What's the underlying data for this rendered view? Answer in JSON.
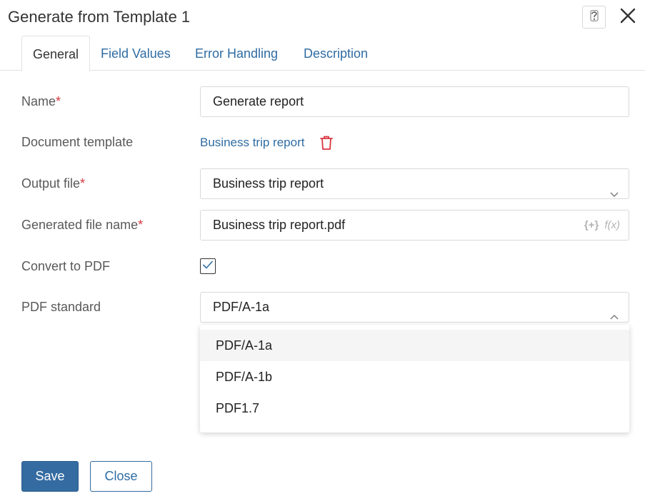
{
  "dialog": {
    "title": "Generate from Template 1"
  },
  "tabs": [
    {
      "label": "General",
      "active": true
    },
    {
      "label": "Field Values",
      "active": false
    },
    {
      "label": "Error Handling",
      "active": false
    },
    {
      "label": "Description",
      "active": false
    }
  ],
  "form": {
    "name": {
      "label": "Name",
      "required_mark": "*",
      "value": "Generate report"
    },
    "document_template": {
      "label": "Document template",
      "link_text": "Business trip report"
    },
    "output_file": {
      "label": "Output file",
      "required_mark": "*",
      "value": "Business trip report"
    },
    "generated_file_name": {
      "label": "Generated file name",
      "required_mark": "*",
      "value": "Business trip report.pdf",
      "insert_icon_text": "{+}",
      "formula_icon_text": "f(x)"
    },
    "convert_to_pdf": {
      "label": "Convert to PDF",
      "checked": true
    },
    "pdf_standard": {
      "label": "PDF standard",
      "value": "PDF/A-1a",
      "options": [
        "PDF/A-1a",
        "PDF/A-1b",
        "PDF1.7"
      ]
    }
  },
  "footer": {
    "save_label": "Save",
    "close_label": "Close"
  },
  "colors": {
    "accent": "#346ba1",
    "link": "#2f6ca3",
    "required": "#d9363e"
  }
}
